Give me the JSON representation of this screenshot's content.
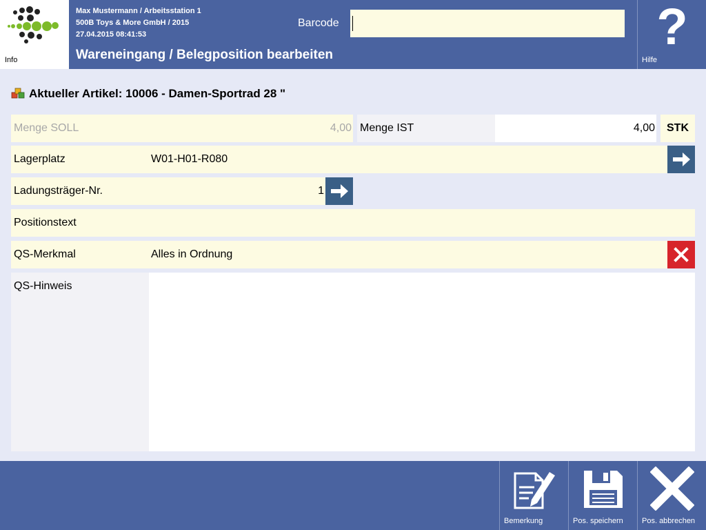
{
  "header": {
    "info_label": "Info",
    "user_line": "Max Mustermann / Arbeitsstation 1",
    "company_line": "500B Toys & More GmbH / 2015",
    "datetime_line": "27.04.2015 08:41:53",
    "title": "Wareneingang / Belegposition bearbeiten",
    "barcode_label": "Barcode",
    "barcode_value": "",
    "help_symbol": "?",
    "help_label": "Hilfe"
  },
  "article": {
    "text": "Aktueller Artikel: 10006 - Damen-Sportrad 28 \""
  },
  "form": {
    "menge_soll_label": "Menge SOLL",
    "menge_soll_value": "4,00",
    "menge_ist_label": "Menge IST",
    "menge_ist_value": "4,00",
    "unit": "STK",
    "lagerplatz_label": "Lagerplatz",
    "lagerplatz_value": "W01-H01-R080",
    "ladungstraeger_label": "Ladungsträger-Nr.",
    "ladungstraeger_value": "1",
    "positionstext_label": "Positionstext",
    "positionstext_value": "",
    "qs_merkmal_label": "QS-Merkmal",
    "qs_merkmal_value": "Alles in Ordnung",
    "qs_hinweis_label": "QS-Hinweis",
    "qs_hinweis_value": ""
  },
  "footer": {
    "buttons": [
      {
        "label": "Bemerkung",
        "icon": "edit-note-icon"
      },
      {
        "label": "Pos. speichern",
        "icon": "floppy-disk-icon"
      },
      {
        "label": "Pos. abbrechen",
        "icon": "close-icon"
      }
    ]
  },
  "colors": {
    "header_bg": "#4a63a0",
    "field_bg": "#fdfbe2",
    "arrow_btn": "#3a5f86",
    "clear_btn": "#d7242b",
    "page_bg": "#e6e9f6"
  }
}
